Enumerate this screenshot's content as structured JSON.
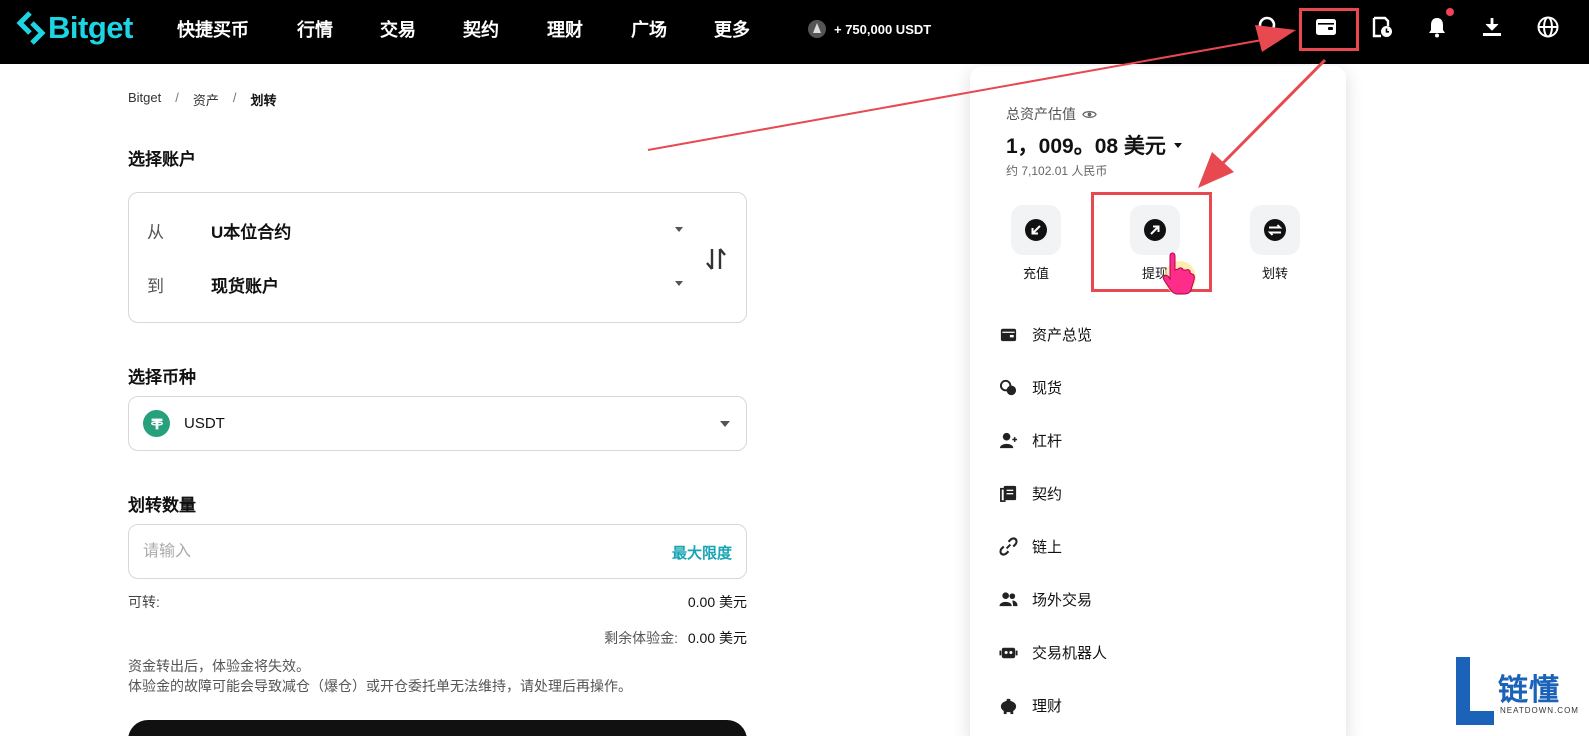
{
  "brand": {
    "name": "Bitget",
    "color": "#1dd4e5"
  },
  "nav": {
    "items": [
      "快捷买币",
      "行情",
      "交易",
      "契约",
      "理财",
      "广场",
      "更多"
    ],
    "promo": "+ 750,000 USDT"
  },
  "icons": {
    "search": "search-icon",
    "wallet": "wallet-icon",
    "orders": "order-history-icon",
    "bell": "bell-icon",
    "download": "download-icon",
    "globe": "globe-icon"
  },
  "breadcrumb": [
    "Bitget",
    "资产",
    "划转"
  ],
  "form": {
    "select_account_title": "选择账户",
    "from_label": "从",
    "from_value": "U本位合约",
    "to_label": "到",
    "to_value": "现货账户",
    "select_coin_title": "选择币种",
    "coin": "USDT",
    "amount_title": "划转数量",
    "amount_placeholder": "请输入",
    "max_label": "最大限度",
    "available_label": "可转:",
    "available_value": "0.00 美元",
    "bonus_label": "剩余体验金:",
    "bonus_value": "0.00 美元",
    "notice_line1": "资金转出后，体验金将失效。",
    "notice_line2": "体验金的故障可能会导致减仓（爆仓）或开仓委托单无法维持，请处理后再操作。"
  },
  "panel": {
    "total_label": "总资产估值",
    "total_value": "1，009。08 美元",
    "cny_value": "约 7,102.01 人民币",
    "quick_actions": [
      {
        "label": "充值",
        "icon": "deposit-icon"
      },
      {
        "label": "提现",
        "icon": "withdraw-icon"
      },
      {
        "label": "划转",
        "icon": "transfer-icon"
      }
    ],
    "menu": [
      {
        "label": "资产总览",
        "icon": "wallet-icon"
      },
      {
        "label": "现货",
        "icon": "coins-icon"
      },
      {
        "label": "杠杆",
        "icon": "user-leverage-icon"
      },
      {
        "label": "契约",
        "icon": "contract-icon"
      },
      {
        "label": "链上",
        "icon": "link-icon"
      },
      {
        "label": "场外交易",
        "icon": "users-icon"
      },
      {
        "label": "交易机器人",
        "icon": "robot-icon"
      },
      {
        "label": "理财",
        "icon": "piggy-bank-icon"
      }
    ]
  },
  "watermark": {
    "text": "链懂",
    "sub": "NEATDOWN.COM"
  },
  "colors": {
    "highlight": "#e8484f",
    "accent": "#1aa4b4",
    "tether": "#26a17b"
  }
}
